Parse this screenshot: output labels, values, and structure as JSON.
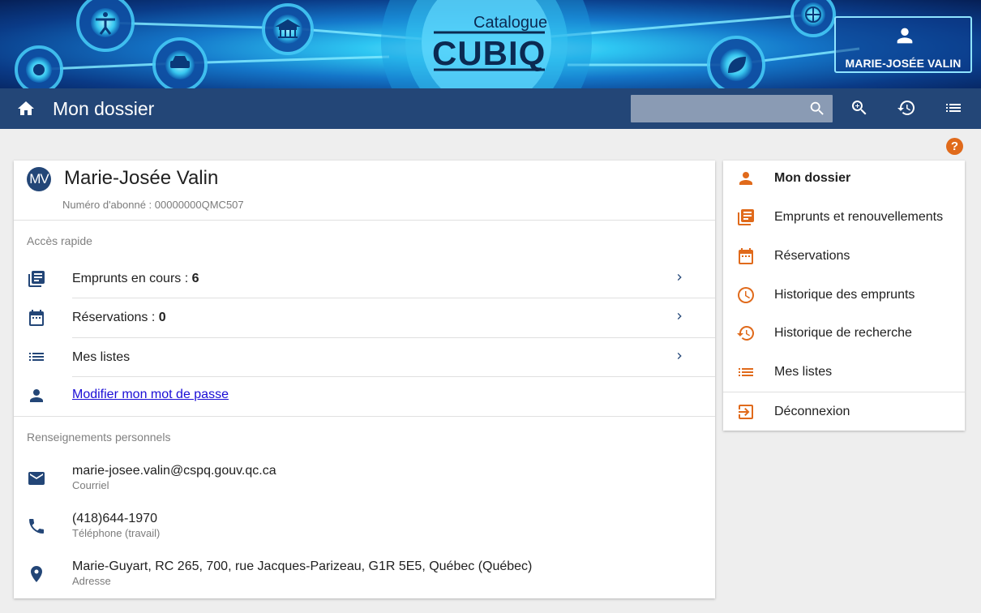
{
  "banner": {
    "catalogue_label": "Catalogue",
    "brand": "CUBIQ",
    "user_name": "MARIE-JOSÉE VALIN"
  },
  "toolbar": {
    "title": "Mon dossier",
    "search_placeholder": "",
    "icons": [
      "home-icon",
      "search-icon",
      "zoom-search-icon",
      "history-icon",
      "list-icon"
    ]
  },
  "profile": {
    "initials": "MV",
    "name": "Marie-Josée Valin",
    "subscriber": "Numéro d'abonné : 00000000QMC507"
  },
  "quick_access": {
    "title": "Accès rapide",
    "loans_label": "Emprunts en cours : ",
    "loans_count": "6",
    "reservations_label": "Réservations : ",
    "reservations_count": "0",
    "lists_label": "Mes listes",
    "password_link": "Modifier mon mot de passe"
  },
  "personal": {
    "title": "Renseignements personnels",
    "email": "marie-josee.valin@cspq.gouv.qc.ca",
    "email_label": "Courriel",
    "phone": "(418)644-1970",
    "phone_label": "Téléphone (travail)",
    "address": "Marie-Guyart, RC 265, 700, rue Jacques-Parizeau, G1R 5E5, Québec (Québec)",
    "address_label": "Adresse"
  },
  "menu": {
    "items": [
      {
        "label": "Mon dossier",
        "icon": "person-icon"
      },
      {
        "label": "Emprunts et renouvellements",
        "icon": "library-books-icon"
      },
      {
        "label": "Réservations",
        "icon": "calendar-icon"
      },
      {
        "label": "Historique des emprunts",
        "icon": "clock-icon"
      },
      {
        "label": "Historique de recherche",
        "icon": "history-icon"
      },
      {
        "label": "Mes listes",
        "icon": "list-icon"
      },
      {
        "label": "Déconnexion",
        "icon": "logout-icon"
      }
    ]
  },
  "colors": {
    "toolbar": "#234677",
    "accent_orange": "#e06a1b",
    "icon_blue": "#234677",
    "link": "#1a0dd6"
  }
}
